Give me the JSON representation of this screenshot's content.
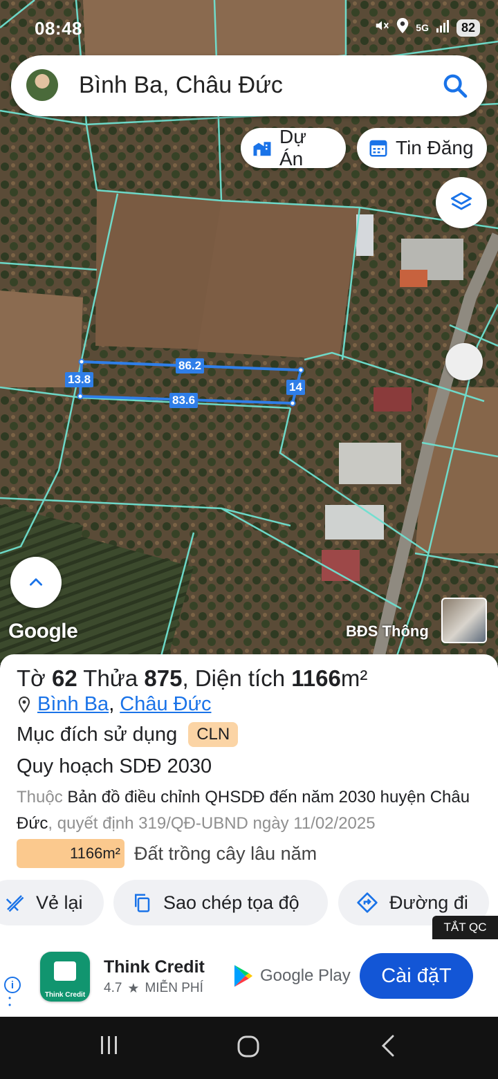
{
  "status_bar": {
    "time": "08:48",
    "network": "5G",
    "battery": "82",
    "icons": [
      "mute-icon",
      "location-icon",
      "5g-icon",
      "signal-icon"
    ]
  },
  "search": {
    "query": "Bình Ba, Châu Đức"
  },
  "chips": [
    {
      "label": "Dự Án",
      "icon": "building-icon"
    },
    {
      "label": "Tin Đăng",
      "icon": "calendar-icon"
    }
  ],
  "map": {
    "measurements": {
      "top": "86.2",
      "bottom": "83.6",
      "left": "13.8",
      "right": "14"
    },
    "logo": "Google",
    "credit": "BĐS Thông",
    "colors": {
      "parcel_line": "#6fe0d0",
      "measure": "#2f7ee8"
    }
  },
  "parcel": {
    "to_label": "Tờ",
    "to_value": "62",
    "thua_label": "Thửa",
    "thua_value": "875",
    "area_label": ", Diện tích",
    "area_value": "1166",
    "area_unit": "m²",
    "commune": "Bình Ba",
    "district": "Châu Đức",
    "purpose_label": "Mục đích sử dụng",
    "purpose_code": "CLN",
    "plan_title": "Quy hoạch SDĐ 2030",
    "plan_prefix": "Thuộc",
    "plan_map": "Bản đồ điều chỉnh QHSDĐ đến năm 2030 huyện Châu Đức",
    "plan_decision": ", quyết định 319/QĐ-UBND ngày 11/02/2025",
    "land_area": "1166m²",
    "land_type": "Đất trồng cây lâu năm",
    "land_color": "#fbc98e"
  },
  "actions": [
    {
      "label": "Vẻ lại",
      "icon": "redraw-icon"
    },
    {
      "label": "Sao chép tọa độ",
      "icon": "copy-icon"
    },
    {
      "label": "Đường đi",
      "icon": "directions-icon"
    }
  ],
  "ad": {
    "close_label": "TẮT QC",
    "app_name": "Think Credit",
    "icon_label": "Think Credit",
    "rating": "4.7",
    "price": "MIỄN PHÍ",
    "store": "Google Play",
    "install_label": "Cài đặT"
  }
}
